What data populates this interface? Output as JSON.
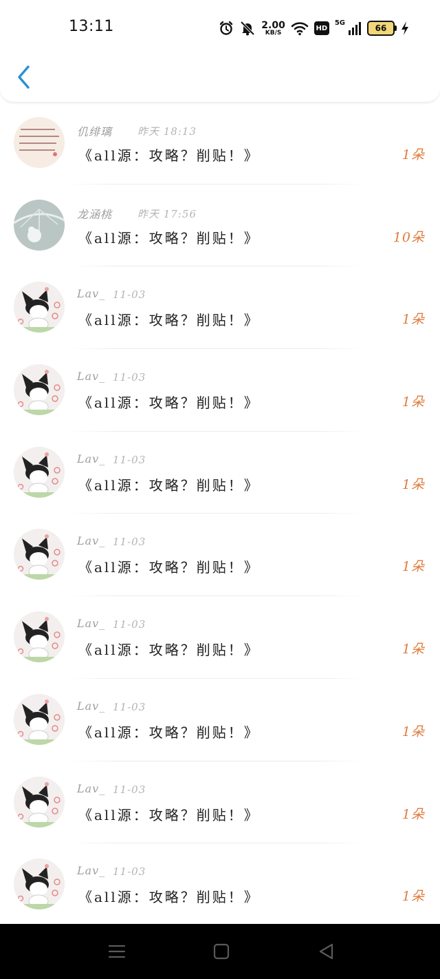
{
  "status_bar": {
    "time": "13:11",
    "speed_value": "2.00",
    "speed_unit": "KB/S",
    "hd_label": "HD",
    "network_label": "5G",
    "battery_level": "66",
    "icons": [
      "alarm-icon",
      "mute-icon",
      "wifi-icon",
      "signal-icon",
      "battery-icon",
      "charging-icon"
    ]
  },
  "header": {
    "back_icon": "chevron-left-icon"
  },
  "list": {
    "items": [
      {
        "name": "仉绯璃",
        "date": "昨天 18:13",
        "title": "《all源：攻略？削贴！》",
        "count": "1朵"
      },
      {
        "name": "龙涵桃",
        "date": "昨天 17:56",
        "title": "《all源：攻略？削贴！》",
        "count": "10朵"
      },
      {
        "name": "Lav_",
        "date": "11-03",
        "title": "《all源：攻略？削贴！》",
        "count": "1朵"
      },
      {
        "name": "Lav_",
        "date": "11-03",
        "title": "《all源：攻略？削贴！》",
        "count": "1朵"
      },
      {
        "name": "Lav_",
        "date": "11-03",
        "title": "《all源：攻略？削贴！》",
        "count": "1朵"
      },
      {
        "name": "Lav_",
        "date": "11-03",
        "title": "《all源：攻略？削贴！》",
        "count": "1朵"
      },
      {
        "name": "Lav_",
        "date": "11-03",
        "title": "《all源：攻略？削贴！》",
        "count": "1朵"
      },
      {
        "name": "Lav_",
        "date": "11-03",
        "title": "《all源：攻略？削贴！》",
        "count": "1朵"
      },
      {
        "name": "Lav_",
        "date": "11-03",
        "title": "《all源：攻略？削贴！》",
        "count": "1朵"
      },
      {
        "name": "Lav_",
        "date": "11-03",
        "title": "《all源：攻略？削贴！》",
        "count": "1朵"
      }
    ]
  },
  "nav_bar": {
    "icons": [
      "menu-icon",
      "home-icon",
      "back-icon"
    ]
  },
  "colors": {
    "accent": "#2a8fd6",
    "count": "#e07b3c",
    "name": "#9e9e9e",
    "text": "#222222"
  }
}
